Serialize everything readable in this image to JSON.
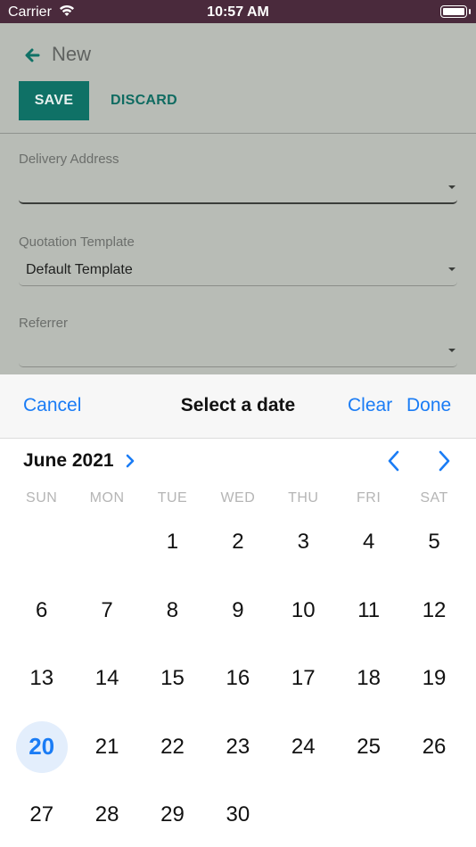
{
  "status_bar": {
    "carrier": "Carrier",
    "time": "10:57 AM"
  },
  "header": {
    "title": "New",
    "save_label": "SAVE",
    "discard_label": "DISCARD"
  },
  "form": {
    "delivery_address": {
      "label": "Delivery Address",
      "value": ""
    },
    "quotation_template": {
      "label": "Quotation Template",
      "value": "Default Template"
    },
    "referrer": {
      "label": "Referrer",
      "value": ""
    }
  },
  "date_picker": {
    "cancel_label": "Cancel",
    "title": "Select a date",
    "clear_label": "Clear",
    "done_label": "Done",
    "month_label": "June 2021",
    "weekdays": [
      "SUN",
      "MON",
      "TUE",
      "WED",
      "THU",
      "FRI",
      "SAT"
    ],
    "leading_blanks": 2,
    "days": [
      "1",
      "2",
      "3",
      "4",
      "5",
      "6",
      "7",
      "8",
      "9",
      "10",
      "11",
      "12",
      "13",
      "14",
      "15",
      "16",
      "17",
      "18",
      "19",
      "20",
      "21",
      "22",
      "23",
      "24",
      "25",
      "26",
      "27",
      "28",
      "29",
      "30"
    ],
    "selected_day": "20"
  },
  "colors": {
    "accent_blue": "#1a7cf5",
    "brand_teal": "#0f7166",
    "status_bar": "#4a2a3c"
  }
}
